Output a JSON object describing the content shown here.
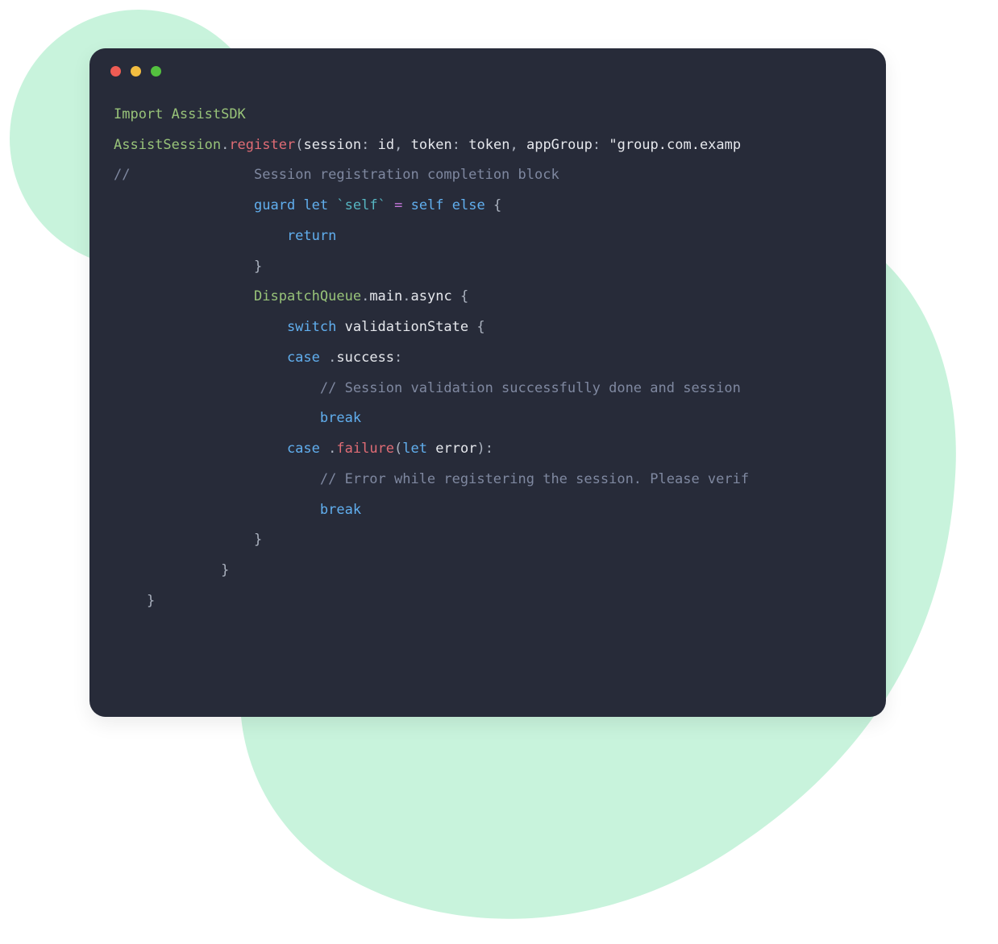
{
  "window": {
    "dots": {
      "red": "#ee5c54",
      "yellow": "#f2bd40",
      "green": "#54c13f"
    }
  },
  "code": {
    "l1": {
      "import_kw": "Import",
      "module": "AssistSDK"
    },
    "l2": {
      "cls": "AssistSession",
      "dot": ".",
      "method": "register",
      "open": "(",
      "p1_label": "session",
      "colon": ":",
      "sp": " ",
      "p1_val": "id",
      "comma": ",",
      "p2_label": "token",
      "p2_val": "token",
      "p3_label": "appGroup",
      "p3_val": "\"group.com.examp"
    },
    "l3": {
      "slashes": "//",
      "text": "Session registration completion block"
    },
    "l4": {
      "guard": "guard",
      "let": "let",
      "lself": "`self`",
      "eq": "=",
      "rself": "self",
      "else_kw": "else",
      "brace": "{"
    },
    "l5": {
      "return_kw": "return"
    },
    "l6": {
      "brace": "}"
    },
    "l7": {
      "cls": "DispatchQueue",
      "dot": ".",
      "main": "main",
      "async": "async",
      "brace": "{"
    },
    "l8": {
      "switch_kw": "switch",
      "ident": "validationState",
      "brace": "{"
    },
    "l9": {
      "case_kw": "case",
      "dot": ".",
      "ident": "success",
      "colon": ":"
    },
    "l10": {
      "text": "// Session validation successfully done and session"
    },
    "l11": {
      "break_kw": "break"
    },
    "l12": {
      "case_kw": "case",
      "dot": ".",
      "ident": "failure",
      "open": "(",
      "let": "let",
      "err": "error",
      "close": ")",
      "colon": ":"
    },
    "l13": {
      "text": "// Error while registering the session. Please verif"
    },
    "l14": {
      "break_kw": "break"
    },
    "l15": {
      "brace": "}"
    },
    "l16": {
      "brace": "}"
    },
    "l17": {
      "brace": "}"
    }
  }
}
